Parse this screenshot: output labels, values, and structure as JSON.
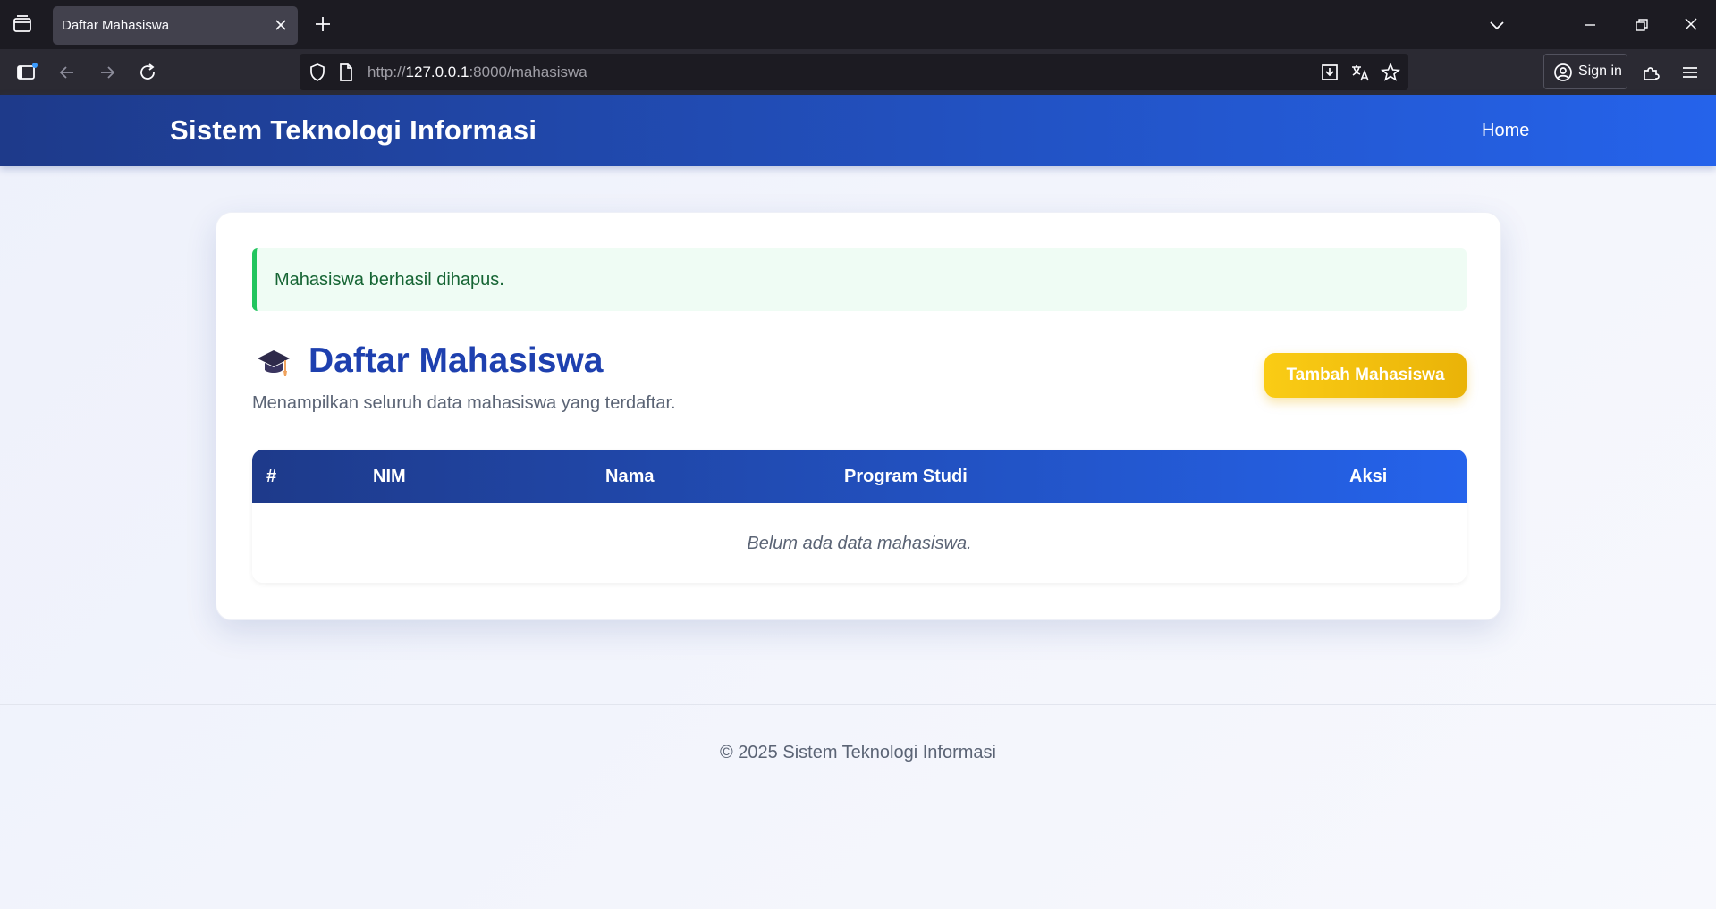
{
  "browser": {
    "tab_title": "Daftar Mahasiswa",
    "url_scheme": "http://",
    "url_host": "127.0.0.1",
    "url_rest": ":8000/mahasiswa",
    "sign_in_label": "Sign in"
  },
  "site": {
    "brand": "Sistem Teknologi Informasi",
    "nav_home": "Home"
  },
  "alert": {
    "message": "Mahasiswa berhasil dihapus."
  },
  "page": {
    "title": "Daftar Mahasiswa",
    "subtitle": "Menampilkan seluruh data mahasiswa yang terdaftar.",
    "add_button": "Tambah Mahasiswa"
  },
  "table": {
    "headers": [
      "#",
      "NIM",
      "Nama",
      "Program Studi",
      "Aksi"
    ],
    "rows": [],
    "empty_message": "Belum ada data mahasiswa."
  },
  "footer": {
    "text": "© 2025 Sistem Teknologi Informasi"
  },
  "colors": {
    "primary": "#1e40af",
    "accent": "#facc15",
    "success": "#22c55e"
  }
}
